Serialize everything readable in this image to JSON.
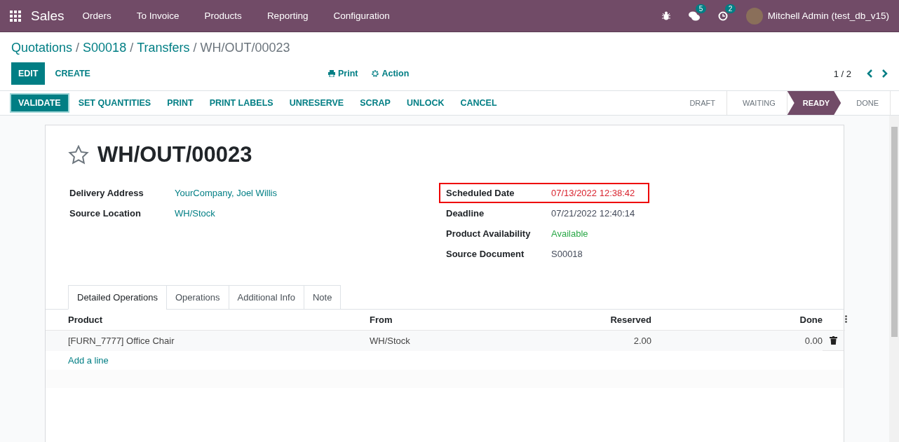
{
  "navbar": {
    "app": "Sales",
    "menus": [
      "Orders",
      "To Invoice",
      "Products",
      "Reporting",
      "Configuration"
    ],
    "messages_count": "5",
    "activities_count": "2",
    "user": "Mitchell Admin (test_db_v15)"
  },
  "breadcrumbs": [
    {
      "label": "Quotations",
      "link": true
    },
    {
      "separator": "/",
      "label": "S00018",
      "link": true
    },
    {
      "separator": "/",
      "label": "Transfers",
      "link": true
    },
    {
      "separator": "/",
      "label": "WH/OUT/00023",
      "link": false
    }
  ],
  "control_buttons": [
    {
      "label": "EDIT",
      "kind": "primary"
    },
    {
      "label": "CREATE",
      "kind": "secondary"
    }
  ],
  "actions": [
    "Print",
    "Action"
  ],
  "pager": "1 / 2",
  "header_buttons": [
    {
      "label": "VALIDATE",
      "kind": "primary"
    },
    {
      "label": "SET QUANTITIES",
      "kind": "secondary"
    },
    {
      "label": "PRINT",
      "kind": "secondary"
    },
    {
      "label": "PRINT LABELS",
      "kind": "secondary"
    },
    {
      "label": "UNRESERVE",
      "kind": "secondary"
    },
    {
      "label": "SCRAP",
      "kind": "secondary"
    },
    {
      "label": "UNLOCK",
      "kind": "secondary"
    },
    {
      "label": "CANCEL",
      "kind": "secondary"
    }
  ],
  "stages": [
    {
      "label": "DRAFT",
      "selected": false
    },
    {
      "label": "WAITING",
      "selected": false
    },
    {
      "label": "READY",
      "selected": true
    },
    {
      "label": "DONE",
      "selected": false
    }
  ],
  "record": {
    "title": "WH/OUT/00023",
    "starred": false,
    "left_fields": [
      {
        "label": "Delivery Address",
        "value": "YourCompany, Joel Willis",
        "kind": "link",
        "highlighted": false
      },
      {
        "label": "Source Location",
        "value": "WH/Stock",
        "kind": "link",
        "highlighted": false
      }
    ],
    "right_fields": [
      {
        "label": "Scheduled Date",
        "value": "07/13/2022 12:38:42",
        "kind": "overdue",
        "highlighted": true
      },
      {
        "label": "Deadline",
        "value": "07/21/2022 12:40:14",
        "kind": "plain",
        "highlighted": false
      },
      {
        "label": "Product Availability",
        "value": "Available",
        "kind": "success",
        "highlighted": false
      },
      {
        "label": "Source Document",
        "value": "S00018",
        "kind": "plain",
        "highlighted": false
      }
    ]
  },
  "tabs": [
    {
      "label": "Detailed Operations",
      "selected": true
    },
    {
      "label": "Operations",
      "selected": false
    },
    {
      "label": "Additional Info",
      "selected": false
    },
    {
      "label": "Note",
      "selected": false
    }
  ],
  "table": {
    "columns": [
      "Product",
      "From",
      "Reserved",
      "Done"
    ],
    "rows": [
      {
        "product": "[FURN_7777] Office Chair",
        "from": "WH/Stock",
        "reserved": "2.00",
        "done": "0.00"
      }
    ],
    "add_line": "Add a line"
  }
}
